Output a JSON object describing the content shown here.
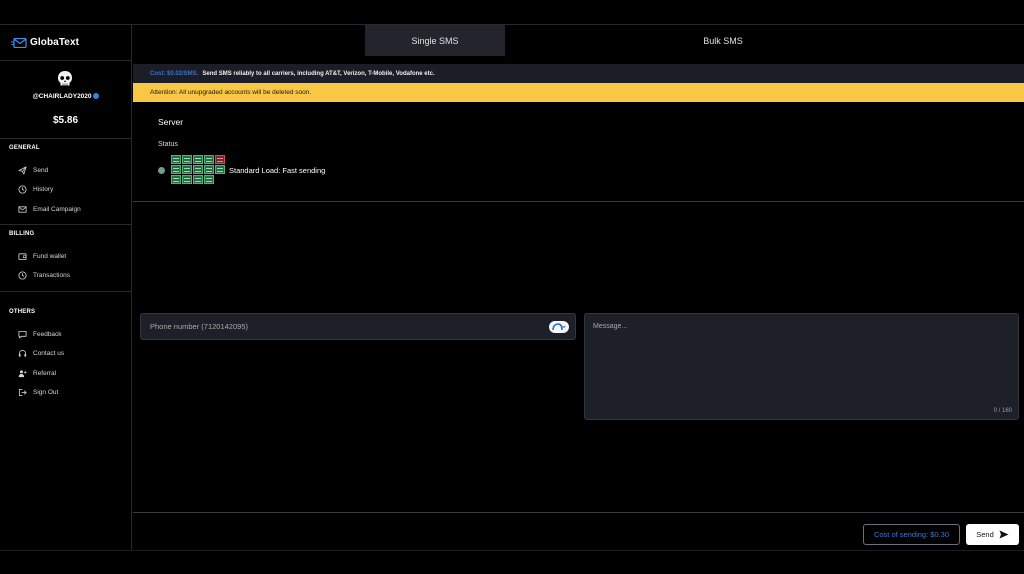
{
  "app": {
    "name": "GlobaText"
  },
  "profile": {
    "username": "@CHAIRLADY2020",
    "balance": "$5.86"
  },
  "sidebar": {
    "sections": [
      {
        "title": "GENERAL",
        "items": [
          {
            "label": "Send",
            "icon": "send-icon"
          },
          {
            "label": "History",
            "icon": "clock-icon"
          },
          {
            "label": "Email Campaign",
            "icon": "mail-icon"
          }
        ]
      },
      {
        "title": "BILLING",
        "items": [
          {
            "label": "Fund wallet",
            "icon": "wallet-icon"
          },
          {
            "label": "Transactions",
            "icon": "clock-icon"
          }
        ]
      },
      {
        "title": "OTHERS",
        "items": [
          {
            "label": "Feedback",
            "icon": "chat-icon"
          },
          {
            "label": "Contact us",
            "icon": "headset-icon"
          },
          {
            "label": "Referral",
            "icon": "user-plus-icon"
          },
          {
            "label": "Sign Out",
            "icon": "sign-out-icon"
          }
        ]
      }
    ]
  },
  "tabs": [
    {
      "label": "Single SMS",
      "active": true
    },
    {
      "label": "Bulk SMS",
      "active": false
    }
  ],
  "banners": {
    "cost_accent": "Cost: $0.02/SMS.",
    "cost_text": "Send SMS reliably to all carriers, including AT&T, Verizon, T-Mobile, Vodafone etc.",
    "warning": "Attention: All unupgraded accounts will be deleted soon."
  },
  "server": {
    "title": "Server",
    "status_label": "Status",
    "load_text": "Standard Load: Fast sending",
    "status_color": "#6f9f86"
  },
  "form": {
    "phone_placeholder": "Phone number (7120142095)",
    "message_placeholder": "Message...",
    "char_counter": "0 / 160"
  },
  "footer": {
    "cost_label": "Cost of sending: $0.30",
    "send_label": "Send"
  },
  "colors": {
    "accent_blue": "#3d78d0",
    "warning_yellow": "#f8c744",
    "background": "#000000",
    "panel": "#1e2029"
  }
}
